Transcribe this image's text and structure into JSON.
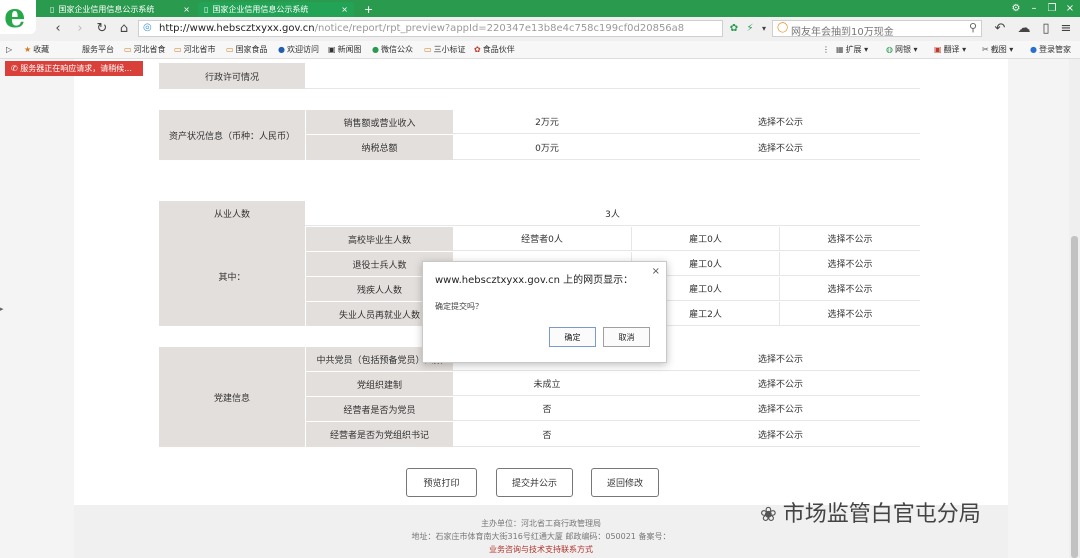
{
  "browser": {
    "tabs": [
      {
        "label": "国家企业信用信息公示系统",
        "active": false
      },
      {
        "label": "国家企业信用信息公示系统",
        "active": true
      }
    ],
    "new_tab": "+",
    "url_host": "http://www.hebscztxyxx.gov.cn",
    "url_path": "/notice/report/rpt_preview?appId=220347e13b8e4c758c199cf0d20856a8",
    "search_text": "网友年会抽到10万现金",
    "bookmarks": [
      "收藏",
      "服务平台",
      "河北省食",
      "河北省市",
      "国家食品",
      "欢迎访问",
      "新闻图",
      "微信公众",
      "三小标证",
      "食品伙伴"
    ],
    "right_tools": [
      "扩展",
      "网银",
      "翻译",
      "截图",
      "登录管家"
    ],
    "error_notice": "服务器正在响应请求，请稍候..."
  },
  "report": {
    "row_admin_license": "行政许可情况",
    "asset_section": "资产状况信息（币种：人民币）",
    "sales_label": "销售额或营业收入",
    "sales_value": "2万元",
    "tax_label": "纳税总额",
    "tax_value": "0万元",
    "not_public": "选择不公示",
    "employees_label": "从业人数",
    "employees_value": "3人",
    "among_label": "其中：",
    "sub_rows": [
      {
        "label": "高校毕业生人数",
        "operator": "经营者0人",
        "hired": "雇工0人",
        "note": "选择不公示"
      },
      {
        "label": "退役士兵人数",
        "operator": "",
        "hired": "雇工0人",
        "note": "选择不公示"
      },
      {
        "label": "残疾人人数",
        "operator": "",
        "hired": "雇工0人",
        "note": "选择不公示"
      },
      {
        "label": "失业人员再就业人数",
        "operator": "",
        "hired": "雇工2人",
        "note": "选择不公示"
      }
    ],
    "party_section": "党建信息",
    "party_rows": [
      {
        "label": "中共党员（包括预备党员）人数",
        "value": "",
        "note": "选择不公示"
      },
      {
        "label": "党组织建制",
        "value": "未成立",
        "note": "选择不公示"
      },
      {
        "label": "经营者是否为党员",
        "value": "否",
        "note": "选择不公示"
      },
      {
        "label": "经营者是否为党组织书记",
        "value": "否",
        "note": "选择不公示"
      }
    ]
  },
  "buttons": {
    "print": "预览打印",
    "submit": "提交并公示",
    "back": "返回修改"
  },
  "footer": {
    "line1": "主办单位：河北省工商行政管理局",
    "line2": "地址：石家庄市体育南大街316号红通大厦 邮政编码：050021 备案号：",
    "line3": "业务咨询与技术支持联系方式"
  },
  "dialog": {
    "title": "www.hebscztxyxx.gov.cn 上的网页显示：",
    "message": "确定提交吗？",
    "ok": "确定",
    "cancel": "取消",
    "close": "×"
  },
  "watermark": "市场监管白官屯分局"
}
